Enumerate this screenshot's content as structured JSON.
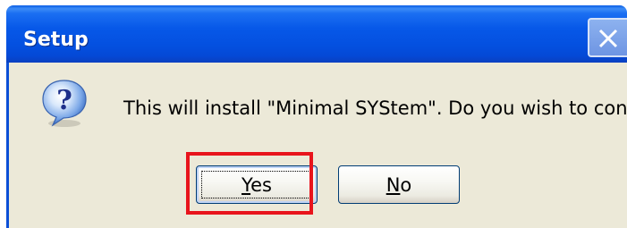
{
  "window": {
    "title": "Setup"
  },
  "message": {
    "text": "This will install \"Minimal SYStem\". Do you wish to continue?",
    "icon": "question-icon"
  },
  "buttons": {
    "yes": {
      "label": "Yes",
      "accesskey": "Y",
      "rest": "es"
    },
    "no": {
      "label": "No",
      "accesskey": "N",
      "rest": "o"
    }
  },
  "annotation": {
    "highlight_color": "#e8141c",
    "highlighted": "yes-button"
  },
  "colors": {
    "titlebar": "#0758e8",
    "body": "#ece9d8"
  }
}
